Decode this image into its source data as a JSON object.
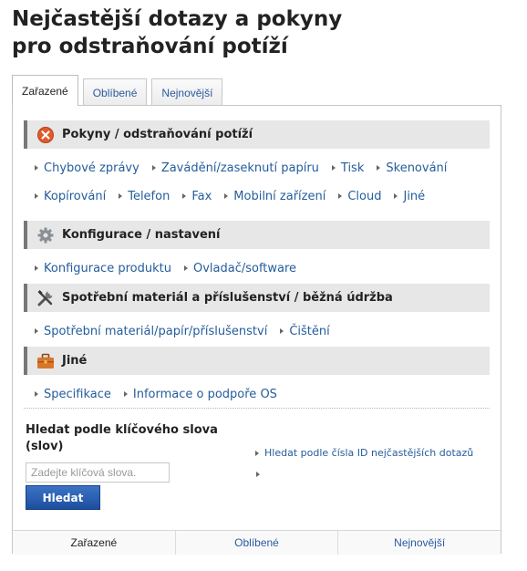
{
  "page": {
    "title_line1": "Nejčastější dotazy a pokyny",
    "title_line2": "pro odstraňování potíží"
  },
  "tabs": [
    {
      "label": "Zařazené",
      "active": true
    },
    {
      "label": "Oblíbené",
      "active": false
    },
    {
      "label": "Nejnovější",
      "active": false
    }
  ],
  "categories": [
    {
      "title": "Pokyny / odstraňování potíží",
      "icon": "error-x-icon",
      "rows": [
        [
          "Chybové zprávy",
          "Zavádění/zaseknutí papíru",
          "Tisk",
          "Skenování"
        ],
        [
          "Kopírování",
          "Telefon",
          "Fax",
          "Mobilní zařízení",
          "Cloud",
          "Jiné"
        ]
      ]
    },
    {
      "title": "Konfigurace / nastavení",
      "icon": "gear-icon",
      "rows": [
        [
          "Konfigurace produktu",
          "Ovladač/software"
        ]
      ]
    },
    {
      "title": "Spotřební materiál a příslušenství / běžná údržba",
      "icon": "tools-icon",
      "rows": [
        [
          "Spotřební materiál/papír/příslušenství",
          "Čištění"
        ]
      ]
    },
    {
      "title": "Jiné",
      "icon": "briefcase-icon",
      "rows": [
        [
          "Specifikace",
          "Informace o podpoře OS"
        ]
      ]
    }
  ],
  "search": {
    "label": "Hledat podle klíčového slova (slov)",
    "placeholder": "Zadejte klíčová slova.",
    "value": "",
    "button_label": "Hledat",
    "id_search_link": "Hledat podle čísla ID nejčastějších dotazů"
  },
  "bottom_tabs": [
    "Zařazené",
    "Oblíbené",
    "Nejnovější"
  ],
  "colors": {
    "link": "#245d9c",
    "header_bg": "#e7e7e7",
    "button": "#2a5fb0",
    "error_icon": "#e05a2b",
    "briefcase_icon": "#d9762b"
  }
}
